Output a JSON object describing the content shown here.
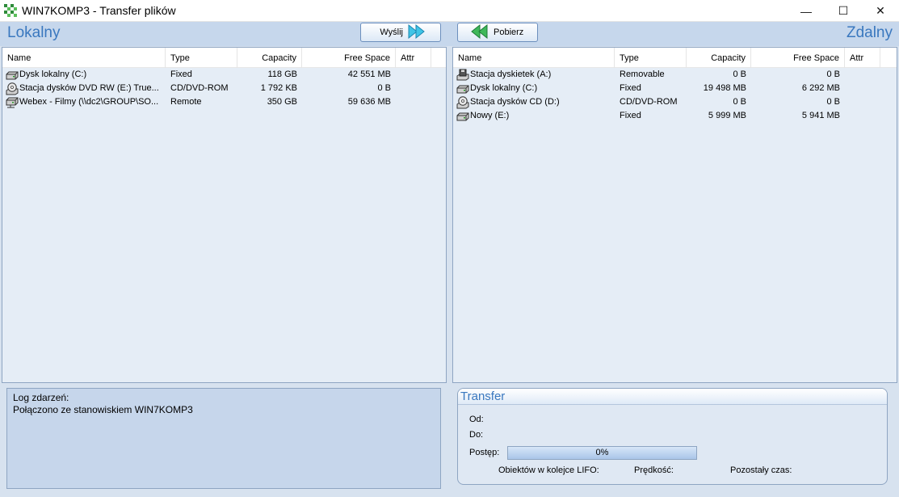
{
  "window": {
    "title": "WIN7KOMP3 - Transfer plików",
    "controls": {
      "minimize": "—",
      "maximize": "☐",
      "close": "✕"
    }
  },
  "toolbar": {
    "local_label": "Lokalny",
    "remote_label": "Zdalny",
    "send_label": "Wyślij",
    "get_label": "Pobierz"
  },
  "columns": [
    "Name",
    "Type",
    "Capacity",
    "Free Space",
    "Attr"
  ],
  "local": {
    "rows": [
      {
        "icon": "hard-drive-icon",
        "name": "Dysk lokalny (C:)",
        "type": "Fixed",
        "capacity": "118 GB",
        "free": "42 551 MB",
        "attr": ""
      },
      {
        "icon": "cd-drive-icon",
        "name": "Stacja dysków DVD RW (E:) True...",
        "type": "CD/DVD-ROM",
        "capacity": "1 792 KB",
        "free": "0 B",
        "attr": ""
      },
      {
        "icon": "network-drive-icon",
        "name": "Webex - Filmy (\\\\dc2\\GROUP\\SO...",
        "type": "Remote",
        "capacity": "350 GB",
        "free": "59 636 MB",
        "attr": ""
      }
    ]
  },
  "remote": {
    "rows": [
      {
        "icon": "floppy-drive-icon",
        "name": "Stacja dyskietek (A:)",
        "type": "Removable",
        "capacity": "0 B",
        "free": "0 B",
        "attr": ""
      },
      {
        "icon": "hard-drive-icon",
        "name": "Dysk lokalny (C:)",
        "type": "Fixed",
        "capacity": "19 498 MB",
        "free": "6 292 MB",
        "attr": ""
      },
      {
        "icon": "cd-drive-icon",
        "name": "Stacja dysków CD (D:)",
        "type": "CD/DVD-ROM",
        "capacity": "0 B",
        "free": "0 B",
        "attr": ""
      },
      {
        "icon": "hard-drive-icon",
        "name": "Nowy (E:)",
        "type": "Fixed",
        "capacity": "5 999 MB",
        "free": "5 941 MB",
        "attr": ""
      }
    ]
  },
  "log": {
    "title": "Log zdarzeń:",
    "lines": [
      "Połączono ze stanowiskiem WIN7KOMP3"
    ]
  },
  "transfer": {
    "title": "Transfer",
    "from_label": "Od:",
    "to_label": "Do:",
    "progress_label": "Postęp:",
    "progress_text": "0%",
    "progress_value": 0,
    "queue_label": "Obiektów w kolejce LIFO:",
    "speed_label": "Prędkość:",
    "remaining_label": "Pozostały czas:"
  },
  "colors": {
    "accent": "#3a78bf",
    "panel": "#e5edf6",
    "background": "#d7e2ef"
  }
}
